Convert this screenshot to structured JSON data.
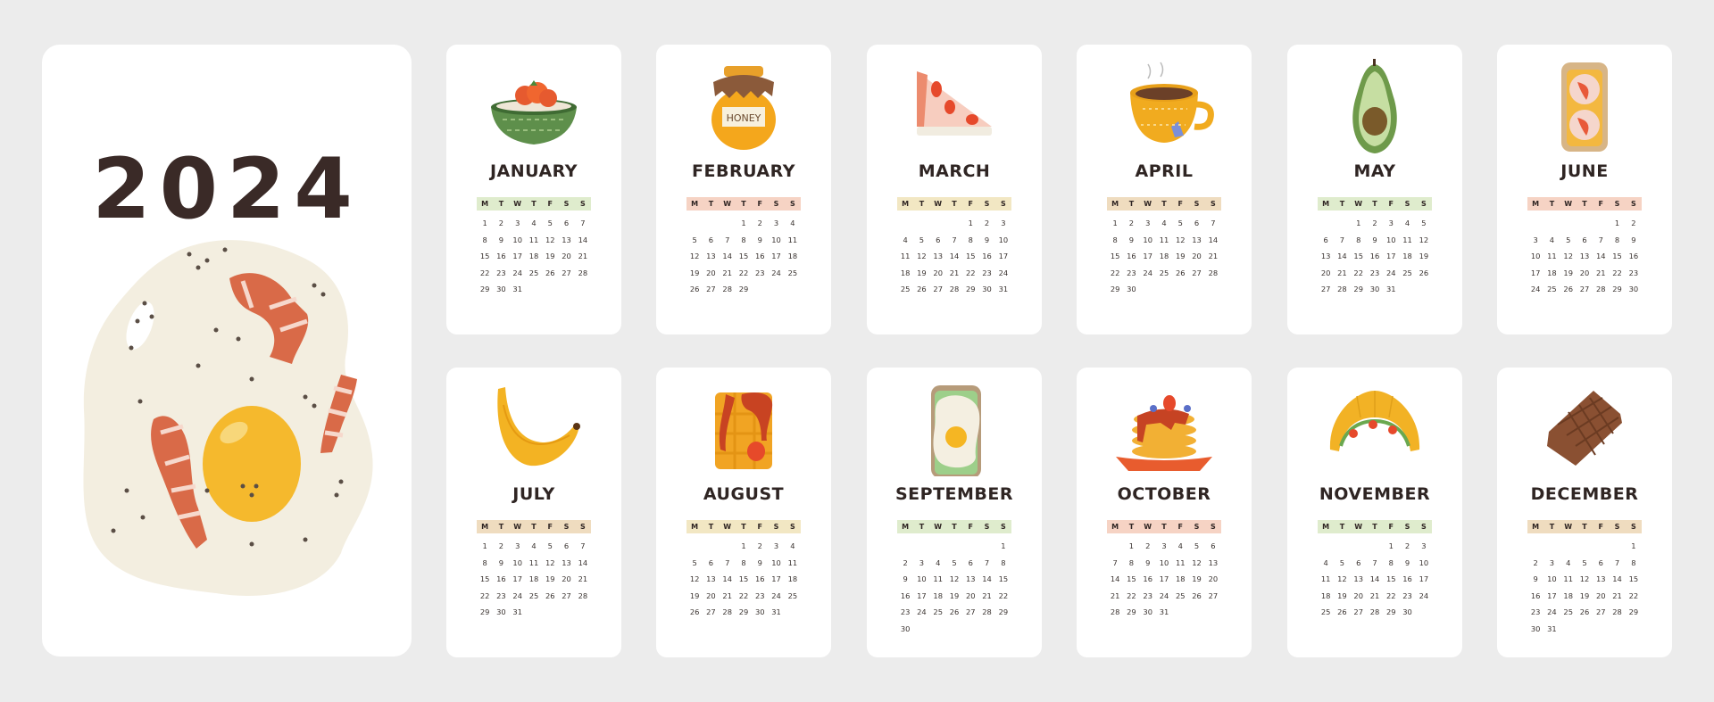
{
  "calendar": {
    "year": "2024",
    "weekday_headers": [
      "M",
      "T",
      "W",
      "T",
      "F",
      "S",
      "S"
    ],
    "colors": {
      "background": "#ececec",
      "card": "#ffffff",
      "text_dark": "#2f2523",
      "header_green": "#dfeccd",
      "header_pink": "#f6d3c4",
      "header_yellow": "#f2e7c3",
      "header_tan": "#efdcbf"
    },
    "cover": {
      "title": "2024",
      "illustration": "fried-egg-with-bacon"
    },
    "months": [
      {
        "name": "JANUARY",
        "illustration": "bowl-with-strawberries",
        "header_color": "#dfeccd",
        "offset": 0,
        "days": 31
      },
      {
        "name": "FEBRUARY",
        "illustration": "honey-jar",
        "jar_label": "HONEY",
        "header_color": "#f6d3c4",
        "offset": 3,
        "days": 29
      },
      {
        "name": "MARCH",
        "illustration": "strawberry-cake-slice",
        "header_color": "#f2e7c3",
        "offset": 4,
        "days": 31
      },
      {
        "name": "APRIL",
        "illustration": "tea-cup",
        "header_color": "#efdcbf",
        "offset": 0,
        "days": 30
      },
      {
        "name": "MAY",
        "illustration": "avocado",
        "header_color": "#dfeccd",
        "offset": 2,
        "days": 31
      },
      {
        "name": "JUNE",
        "illustration": "toast-with-salmon",
        "header_color": "#f6d3c4",
        "offset": 5,
        "days": 30
      },
      {
        "name": "JULY",
        "illustration": "banana",
        "header_color": "#efdcbf",
        "offset": 0,
        "days": 31
      },
      {
        "name": "AUGUST",
        "illustration": "waffle-with-syrup",
        "header_color": "#f2e7c3",
        "offset": 3,
        "days": 31
      },
      {
        "name": "SEPTEMBER",
        "illustration": "egg-avocado-toast",
        "header_color": "#dfeccd",
        "offset": 6,
        "days": 30
      },
      {
        "name": "OCTOBER",
        "illustration": "pancakes",
        "header_color": "#f6d3c4",
        "offset": 1,
        "days": 31
      },
      {
        "name": "NOVEMBER",
        "illustration": "croissant",
        "header_color": "#dfeccd",
        "offset": 4,
        "days": 30
      },
      {
        "name": "DECEMBER",
        "illustration": "chocolate-bar",
        "header_color": "#efdcbf",
        "offset": 6,
        "days": 31
      }
    ]
  }
}
